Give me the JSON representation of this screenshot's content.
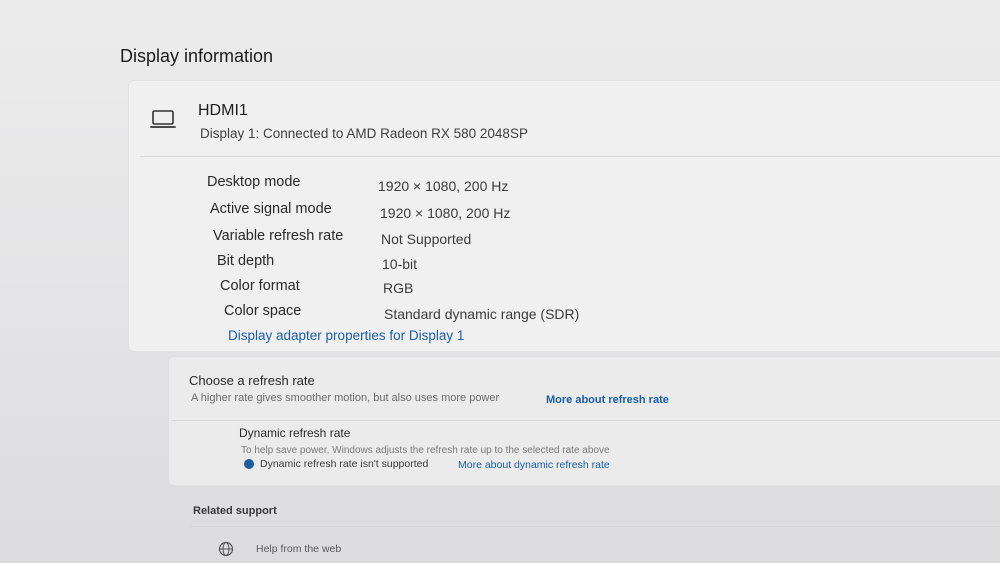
{
  "page": {
    "title": "Display information"
  },
  "monitor": {
    "name": "HDMI1",
    "description": "Display 1: Connected to AMD Radeon RX 580 2048SP",
    "icon": "laptop-monitor-icon"
  },
  "details": [
    {
      "label": "Desktop mode",
      "value": "1920 × 1080, 200 Hz"
    },
    {
      "label": "Active signal mode",
      "value": "1920 × 1080, 200 Hz"
    },
    {
      "label": "Variable refresh rate",
      "value": "Not Supported"
    },
    {
      "label": "Bit depth",
      "value": "10-bit"
    },
    {
      "label": "Color format",
      "value": "RGB"
    },
    {
      "label": "Color space",
      "value": "Standard dynamic range (SDR)"
    }
  ],
  "adapter_link": "Display adapter properties for Display 1",
  "refresh": {
    "title": "Choose a refresh rate",
    "subtitle": "A higher rate gives smoother motion, but also uses more power",
    "more_link": "More about refresh rate"
  },
  "dynamic_refresh": {
    "title": "Dynamic refresh rate",
    "subtitle": "To help save power, Windows adjusts the refresh rate up to the selected rate above",
    "status": "Dynamic refresh rate isn't supported",
    "more_link": "More about dynamic refresh rate",
    "status_icon": "info-icon"
  },
  "related": {
    "title": "Related support",
    "items": [
      {
        "label": "Help from the web",
        "icon": "globe-icon"
      }
    ]
  },
  "colors": {
    "accent": "#1a5fa8",
    "background": "#e6e6e8",
    "card": "#f0f0f0"
  }
}
